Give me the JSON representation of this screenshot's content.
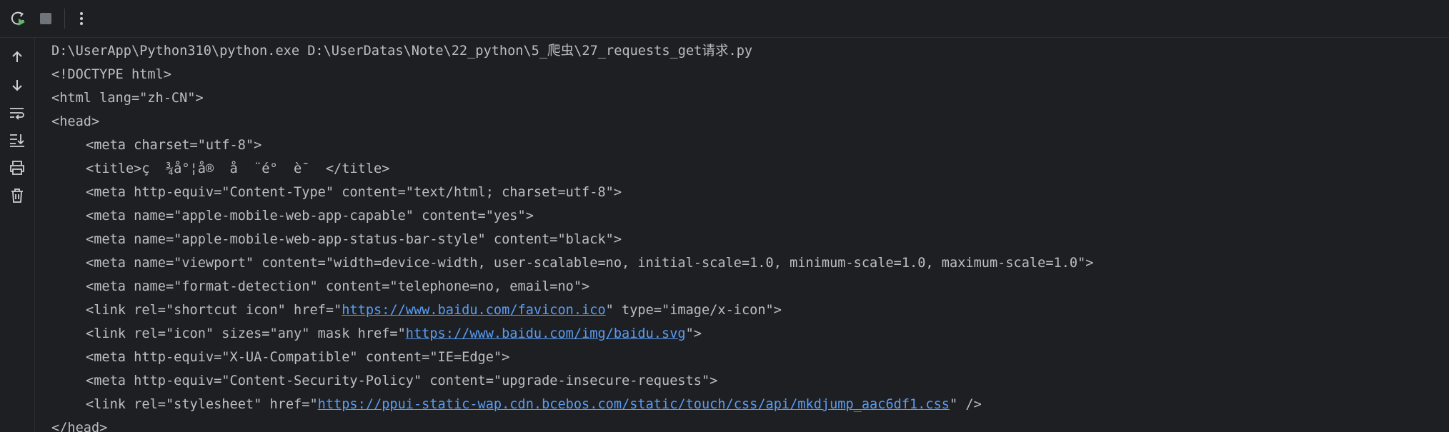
{
  "toolbar": {
    "icons": [
      "rerun-icon",
      "stop-icon",
      "more-vertical-icon"
    ]
  },
  "sidebar": {
    "icons": [
      "arrow-up-icon",
      "arrow-down-icon",
      "soft-wrap-icon",
      "scroll-to-end-icon",
      "print-icon",
      "trash-icon"
    ]
  },
  "colors": {
    "background": "#1e1f22",
    "text": "#bcbec4",
    "link": "#589df6",
    "run_green": "#5fb865"
  },
  "console": {
    "command": "D:\\UserApp\\Python310\\python.exe D:\\UserDatas\\Note\\22_python\\5_爬虫\\27_requests_get请求.py",
    "lines": [
      {
        "text": "<!DOCTYPE html>"
      },
      {
        "text": "<html lang=\"zh-CN\">"
      },
      {
        "text": "<head>"
      },
      {
        "text": "<meta charset=\"utf-8\">",
        "indent": true
      },
      {
        "text": "<title>ç  ¾å°¦å®  å  ¨é°  è¯  </title>",
        "indent": true
      },
      {
        "text": "<meta http-equiv=\"Content-Type\" content=\"text/html; charset=utf-8\">",
        "indent": true
      },
      {
        "text": "<meta name=\"apple-mobile-web-app-capable\" content=\"yes\">",
        "indent": true
      },
      {
        "text": "<meta name=\"apple-mobile-web-app-status-bar-style\" content=\"black\">",
        "indent": true
      },
      {
        "text": "<meta name=\"viewport\" content=\"width=device-width, user-scalable=no, initial-scale=1.0, minimum-scale=1.0, maximum-scale=1.0\">",
        "indent": true
      },
      {
        "text": "<meta name=\"format-detection\" content=\"telephone=no, email=no\">",
        "indent": true
      },
      {
        "pre": "<link rel=\"shortcut icon\" href=\"",
        "link": "https://www.baidu.com/favicon.ico",
        "post": "\" type=\"image/x-icon\">",
        "indent": true
      },
      {
        "pre": "<link rel=\"icon\" sizes=\"any\" mask href=\"",
        "link": "https://www.baidu.com/img/baidu.svg",
        "post": "\">",
        "indent": true
      },
      {
        "text": "<meta http-equiv=\"X-UA-Compatible\" content=\"IE=Edge\">",
        "indent": true
      },
      {
        "text": "<meta http-equiv=\"Content-Security-Policy\" content=\"upgrade-insecure-requests\">",
        "indent": true
      },
      {
        "pre": "<link rel=\"stylesheet\" href=\"",
        "link": "https://ppui-static-wap.cdn.bcebos.com/static/touch/css/api/mkdjump_aac6df1.css",
        "post": "\" />",
        "indent": true
      },
      {
        "text": "</head>"
      }
    ]
  }
}
